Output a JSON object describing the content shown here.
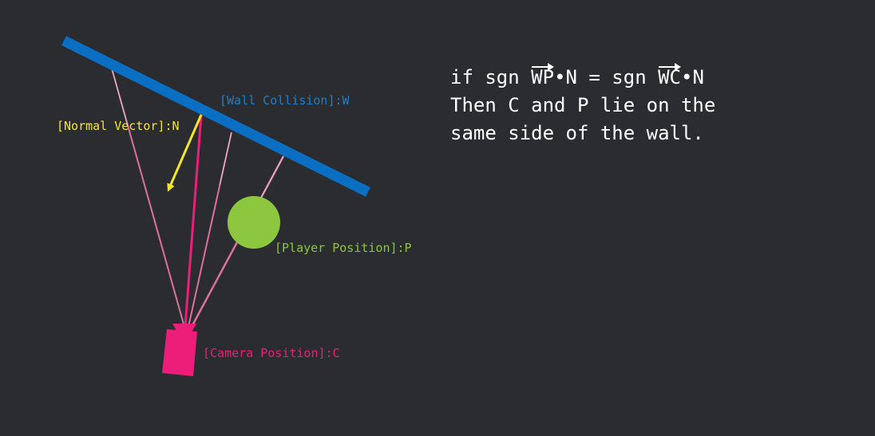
{
  "labels": {
    "wall": "[Wall Collision]:W",
    "normal": "[Normal Vector]:N",
    "player": "[Player Position]:P",
    "camera": "[Camera Position]:C"
  },
  "formula": {
    "line1_if": "if sgn ",
    "vec_wp": "WP",
    "dot_n_eq_sgn": "•N = sgn ",
    "vec_wc": "WC",
    "dot_n": "•N",
    "line2": "Then C and P lie on the",
    "line3": "same side of the wall."
  },
  "colors": {
    "background": "#2b2c2f",
    "wall": "#0a6fc2",
    "wall_label": "#1b7fd0",
    "normal": "#f5e52a",
    "player": "#8dc63f",
    "camera": "#ec1e79",
    "ray": "#f07aa8",
    "thin_ray": "#d9b9c4",
    "text": "#ffffff"
  }
}
